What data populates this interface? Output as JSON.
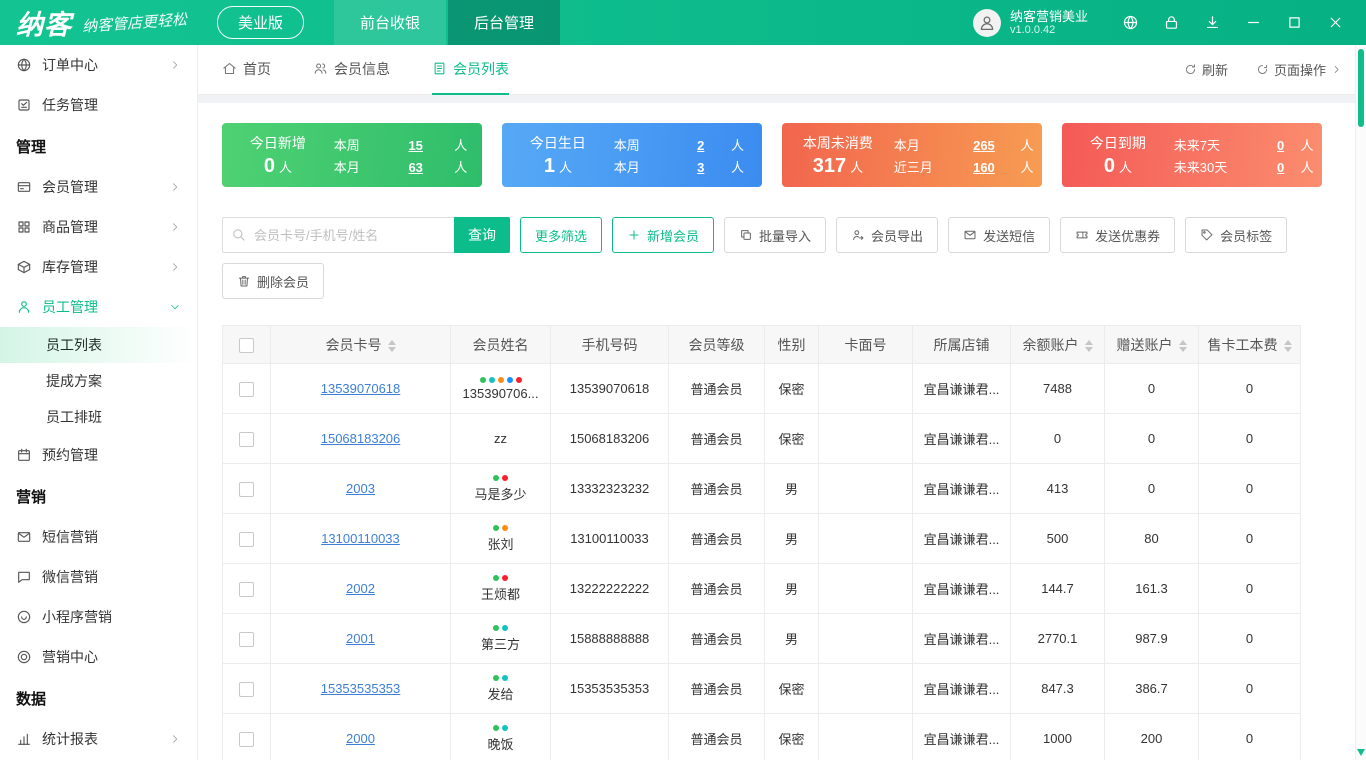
{
  "app": {
    "brand": "纳客",
    "slogan": "纳客管店更轻松",
    "edition": "美业版",
    "nav": [
      {
        "key": "cashier",
        "label": "前台收银",
        "active": false
      },
      {
        "key": "admin",
        "label": "后台管理",
        "active": true
      }
    ],
    "account": {
      "name": "纳客营销美业",
      "version": "v1.0.0.42"
    }
  },
  "sidebar": {
    "items": [
      {
        "type": "item",
        "key": "order-center",
        "icon": "globe",
        "label": "订单中心",
        "chevron": "right"
      },
      {
        "type": "item",
        "key": "task-management",
        "icon": "task",
        "label": "任务管理"
      },
      {
        "type": "section",
        "key": "section-management",
        "label": "管理"
      },
      {
        "type": "item",
        "key": "member-management",
        "icon": "card",
        "label": "会员管理",
        "chevron": "right"
      },
      {
        "type": "item",
        "key": "goods-management",
        "icon": "goods",
        "label": "商品管理",
        "chevron": "right"
      },
      {
        "type": "item",
        "key": "inventory-management",
        "icon": "box",
        "label": "库存管理",
        "chevron": "right"
      },
      {
        "type": "item",
        "key": "staff-management",
        "icon": "person",
        "label": "员工管理",
        "chevron": "down",
        "open": true
      },
      {
        "type": "sub",
        "key": "staff-list",
        "label": "员工列表",
        "active": true
      },
      {
        "type": "sub",
        "key": "commission-plan",
        "label": "提成方案"
      },
      {
        "type": "sub",
        "key": "staff-schedule",
        "label": "员工排班"
      },
      {
        "type": "item",
        "key": "appointment-management",
        "icon": "calendar",
        "label": "预约管理"
      },
      {
        "type": "section",
        "key": "section-marketing",
        "label": "营销"
      },
      {
        "type": "item",
        "key": "sms-marketing",
        "icon": "mail",
        "label": "短信营销"
      },
      {
        "type": "item",
        "key": "wechat-marketing",
        "icon": "chat",
        "label": "微信营销"
      },
      {
        "type": "item",
        "key": "miniprogram-marketing",
        "icon": "mini",
        "label": "小程序营销"
      },
      {
        "type": "item",
        "key": "marketing-center",
        "icon": "target",
        "label": "营销中心"
      },
      {
        "type": "section",
        "key": "section-data",
        "label": "数据"
      },
      {
        "type": "item",
        "key": "statistics-report",
        "icon": "chart",
        "label": "统计报表",
        "chevron": "right"
      }
    ]
  },
  "tabbar": {
    "tabs": [
      {
        "key": "home",
        "icon": "home",
        "label": "首页",
        "active": false
      },
      {
        "key": "member-info",
        "icon": "users",
        "label": "会员信息",
        "active": false
      },
      {
        "key": "member-list",
        "icon": "doc",
        "label": "会员列表",
        "active": true
      }
    ],
    "actions": [
      {
        "key": "refresh",
        "icon": "refresh",
        "label": "刷新",
        "chevron": false
      },
      {
        "key": "page-ops",
        "icon": "ops",
        "label": "页面操作",
        "chevron": true
      }
    ]
  },
  "stat_cards": [
    {
      "key": "new-today",
      "title": "今日新增",
      "value": "0",
      "unit": "人",
      "rows": [
        {
          "label": "本周",
          "num": "15",
          "unit": "人"
        },
        {
          "label": "本月",
          "num": "63",
          "unit": "人"
        }
      ],
      "g1": "#4fd173",
      "g2": "#2fbd6b"
    },
    {
      "key": "birthday-today",
      "title": "今日生日",
      "value": "1",
      "unit": "人",
      "rows": [
        {
          "label": "本周",
          "num": "2",
          "unit": "人"
        },
        {
          "label": "本月",
          "num": "3",
          "unit": "人"
        }
      ],
      "g1": "#57a9f6",
      "g2": "#3b8cf0"
    },
    {
      "key": "no-consume-week",
      "title": "本周未消费",
      "value": "317",
      "unit": "人",
      "rows": [
        {
          "label": "本月",
          "num": "265",
          "unit": "人"
        },
        {
          "label": "近三月",
          "num": "160",
          "unit": "人"
        }
      ],
      "g1": "#f2654e",
      "g2": "#f79c52"
    },
    {
      "key": "expire-today",
      "title": "今日到期",
      "value": "0",
      "unit": "人",
      "rows": [
        {
          "label": "未来7天",
          "num": "0",
          "unit": "人"
        },
        {
          "label": "未来30天",
          "num": "0",
          "unit": "人"
        }
      ],
      "g1": "#f45a56",
      "g2": "#fb8d6e"
    }
  ],
  "toolbar": {
    "search_placeholder": "会员卡号/手机号/姓名",
    "query": "查询",
    "buttons_row1": [
      {
        "key": "more-filter",
        "label": "更多筛选",
        "style": "outline"
      },
      {
        "key": "add-member",
        "label": "新增会员",
        "icon": "plus",
        "style": "outline"
      },
      {
        "key": "batch-import",
        "label": "批量导入",
        "icon": "import",
        "style": "gray"
      },
      {
        "key": "member-export",
        "label": "会员导出",
        "icon": "export",
        "style": "gray"
      },
      {
        "key": "send-sms",
        "label": "发送短信",
        "icon": "mail",
        "style": "gray"
      },
      {
        "key": "send-coupon",
        "label": "发送优惠券",
        "icon": "coupon",
        "style": "gray"
      },
      {
        "key": "member-tags",
        "label": "会员标签",
        "icon": "tag",
        "style": "gray"
      }
    ],
    "buttons_row2": [
      {
        "key": "delete-member",
        "label": "删除会员",
        "icon": "trash",
        "style": "gray"
      }
    ]
  },
  "table": {
    "columns": [
      {
        "label": "会员卡号",
        "sortable": true
      },
      {
        "label": "会员姓名",
        "sortable": false
      },
      {
        "label": "手机号码",
        "sortable": false
      },
      {
        "label": "会员等级",
        "sortable": false
      },
      {
        "label": "性别",
        "sortable": false
      },
      {
        "label": "卡面号",
        "sortable": false
      },
      {
        "label": "所属店铺",
        "sortable": false
      },
      {
        "label": "余额账户",
        "sortable": true
      },
      {
        "label": "赠送账户",
        "sortable": true
      },
      {
        "label": "售卡工本费",
        "sortable": true
      }
    ],
    "rows": [
      {
        "card": "13539070618",
        "dots": [
          "#2fc25b",
          "#13c2c2",
          "#fa8c16",
          "#1890ff",
          "#f5222d"
        ],
        "name": "135390706...",
        "phone": "13539070618",
        "level": "普通会员",
        "gender": "保密",
        "face_no": "",
        "store": "宜昌谦谦君...",
        "balance": "7488",
        "gift": "0",
        "fee": "0"
      },
      {
        "card": "15068183206",
        "dots": [],
        "name": "zz",
        "phone": "15068183206",
        "level": "普通会员",
        "gender": "保密",
        "face_no": "",
        "store": "宜昌谦谦君...",
        "balance": "0",
        "gift": "0",
        "fee": "0"
      },
      {
        "card": "2003",
        "dots": [
          "#2fc25b",
          "#f5222d"
        ],
        "name": "马是多少",
        "phone": "13332323232",
        "level": "普通会员",
        "gender": "男",
        "face_no": "",
        "store": "宜昌谦谦君...",
        "balance": "413",
        "gift": "0",
        "fee": "0"
      },
      {
        "card": "13100110033",
        "dots": [
          "#2fc25b",
          "#fa8c16"
        ],
        "name": "张刘",
        "phone": "13100110033",
        "level": "普通会员",
        "gender": "男",
        "face_no": "",
        "store": "宜昌谦谦君...",
        "balance": "500",
        "gift": "80",
        "fee": "0"
      },
      {
        "card": "2002",
        "dots": [
          "#2fc25b",
          "#f5222d"
        ],
        "name": "王烦都",
        "phone": "13222222222",
        "level": "普通会员",
        "gender": "男",
        "face_no": "",
        "store": "宜昌谦谦君...",
        "balance": "144.7",
        "gift": "161.3",
        "fee": "0"
      },
      {
        "card": "2001",
        "dots": [
          "#2fc25b",
          "#13c2c2"
        ],
        "name": "第三方",
        "phone": "15888888888",
        "level": "普通会员",
        "gender": "男",
        "face_no": "",
        "store": "宜昌谦谦君...",
        "balance": "2770.1",
        "gift": "987.9",
        "fee": "0"
      },
      {
        "card": "15353535353",
        "dots": [
          "#2fc25b",
          "#13c2c2"
        ],
        "name": "发给",
        "phone": "15353535353",
        "level": "普通会员",
        "gender": "保密",
        "face_no": "",
        "store": "宜昌谦谦君...",
        "balance": "847.3",
        "gift": "386.7",
        "fee": "0"
      },
      {
        "card": "2000",
        "dots": [
          "#2fc25b",
          "#13c2c2"
        ],
        "name": "晚饭",
        "phone": "",
        "level": "普通会员",
        "gender": "保密",
        "face_no": "",
        "store": "宜昌谦谦君...",
        "balance": "1000",
        "gift": "200",
        "fee": "0"
      }
    ]
  },
  "colors": {
    "primary": "#0cbd8b",
    "link": "#3d7fd9"
  }
}
